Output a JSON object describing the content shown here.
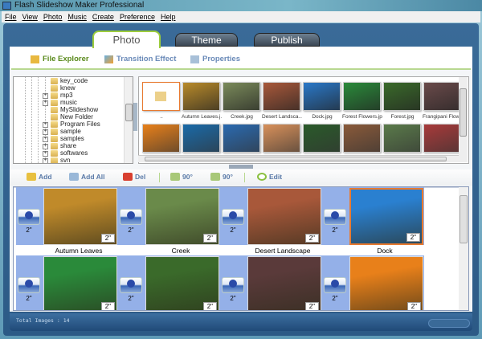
{
  "window": {
    "title": "Flash Slideshow Maker Professional"
  },
  "menu": [
    "File",
    "View",
    "Photo",
    "Music",
    "Create",
    "Preference",
    "Help"
  ],
  "tabs": [
    {
      "label": "Photo",
      "active": true
    },
    {
      "label": "Theme"
    },
    {
      "label": "Publish"
    }
  ],
  "subtabs": [
    {
      "label": "File Explorer",
      "icon": "folder-icon",
      "active": true
    },
    {
      "label": "Transition Effect",
      "icon": "transition-icon"
    },
    {
      "label": "Properties",
      "icon": "properties-icon"
    }
  ],
  "tree": [
    {
      "label": "key_code",
      "expandable": false
    },
    {
      "label": "knew",
      "expandable": false
    },
    {
      "label": "mp3",
      "expandable": true
    },
    {
      "label": "music",
      "expandable": true
    },
    {
      "label": "MySlideshow",
      "expandable": false
    },
    {
      "label": "New Folder",
      "expandable": false
    },
    {
      "label": "Program Files",
      "expandable": true
    },
    {
      "label": "sample",
      "expandable": true
    },
    {
      "label": "samples",
      "expandable": true
    },
    {
      "label": "share",
      "expandable": true
    },
    {
      "label": "softwares",
      "expandable": true
    },
    {
      "label": "svn",
      "expandable": true
    }
  ],
  "grid": {
    "row1": [
      {
        "label": "..",
        "color": "#fff"
      },
      {
        "label": "Autumn Leaves.j...",
        "color": "#b88a2a"
      },
      {
        "label": "Creek.jpg",
        "color": "#7a8a5a"
      },
      {
        "label": "Desert Landsca...",
        "color": "#a8583a"
      },
      {
        "label": "Dock.jpg",
        "color": "#2a78c8"
      },
      {
        "label": "Forest Flowers.jpg",
        "color": "#2a8a3a"
      },
      {
        "label": "Forest.jpg",
        "color": "#3a6a2a"
      },
      {
        "label": "Frangipani Flow...",
        "color": "#6a4a4a"
      }
    ],
    "row2": [
      {
        "color": "#e8801a"
      },
      {
        "color": "#1a6aa8"
      },
      {
        "color": "#2a6ab0"
      },
      {
        "color": "#d8905a"
      },
      {
        "color": "#2a5a2a"
      },
      {
        "color": "#8a5a3a"
      },
      {
        "color": "#5a7a4a"
      },
      {
        "color": "#a83a3a"
      }
    ]
  },
  "toolbar": [
    {
      "label": "Add",
      "icon": "add-icon"
    },
    {
      "label": "Add All",
      "icon": "add-all-icon"
    },
    {
      "label": "Del",
      "icon": "delete-icon"
    },
    {
      "label": "90°",
      "icon": "rotate-left-icon"
    },
    {
      "label": "90°",
      "icon": "rotate-right-icon"
    },
    {
      "label": "Edit",
      "icon": "edit-icon"
    }
  ],
  "storyboard": {
    "transition_duration": "2\"",
    "items": [
      {
        "caption": "Autumn Leaves",
        "duration": "2\"",
        "color": "#c08a2a"
      },
      {
        "caption": "Creek",
        "duration": "2\"",
        "color": "#6a8a4a"
      },
      {
        "caption": "Desert Landscape",
        "duration": "2\"",
        "color": "#a8583a"
      },
      {
        "caption": "Dock",
        "duration": "2\"",
        "color": "#2a80d0",
        "selected": true
      },
      {
        "caption": "",
        "duration": "2\"",
        "color": "#2a8a3a"
      },
      {
        "caption": "",
        "duration": "2\"",
        "color": "#3a6a2a"
      },
      {
        "caption": "",
        "duration": "2\"",
        "color": "#5a3a3a"
      },
      {
        "caption": "",
        "duration": "2\"",
        "color": "#e8801a"
      }
    ]
  },
  "status": {
    "text": "Total Images : 14"
  }
}
